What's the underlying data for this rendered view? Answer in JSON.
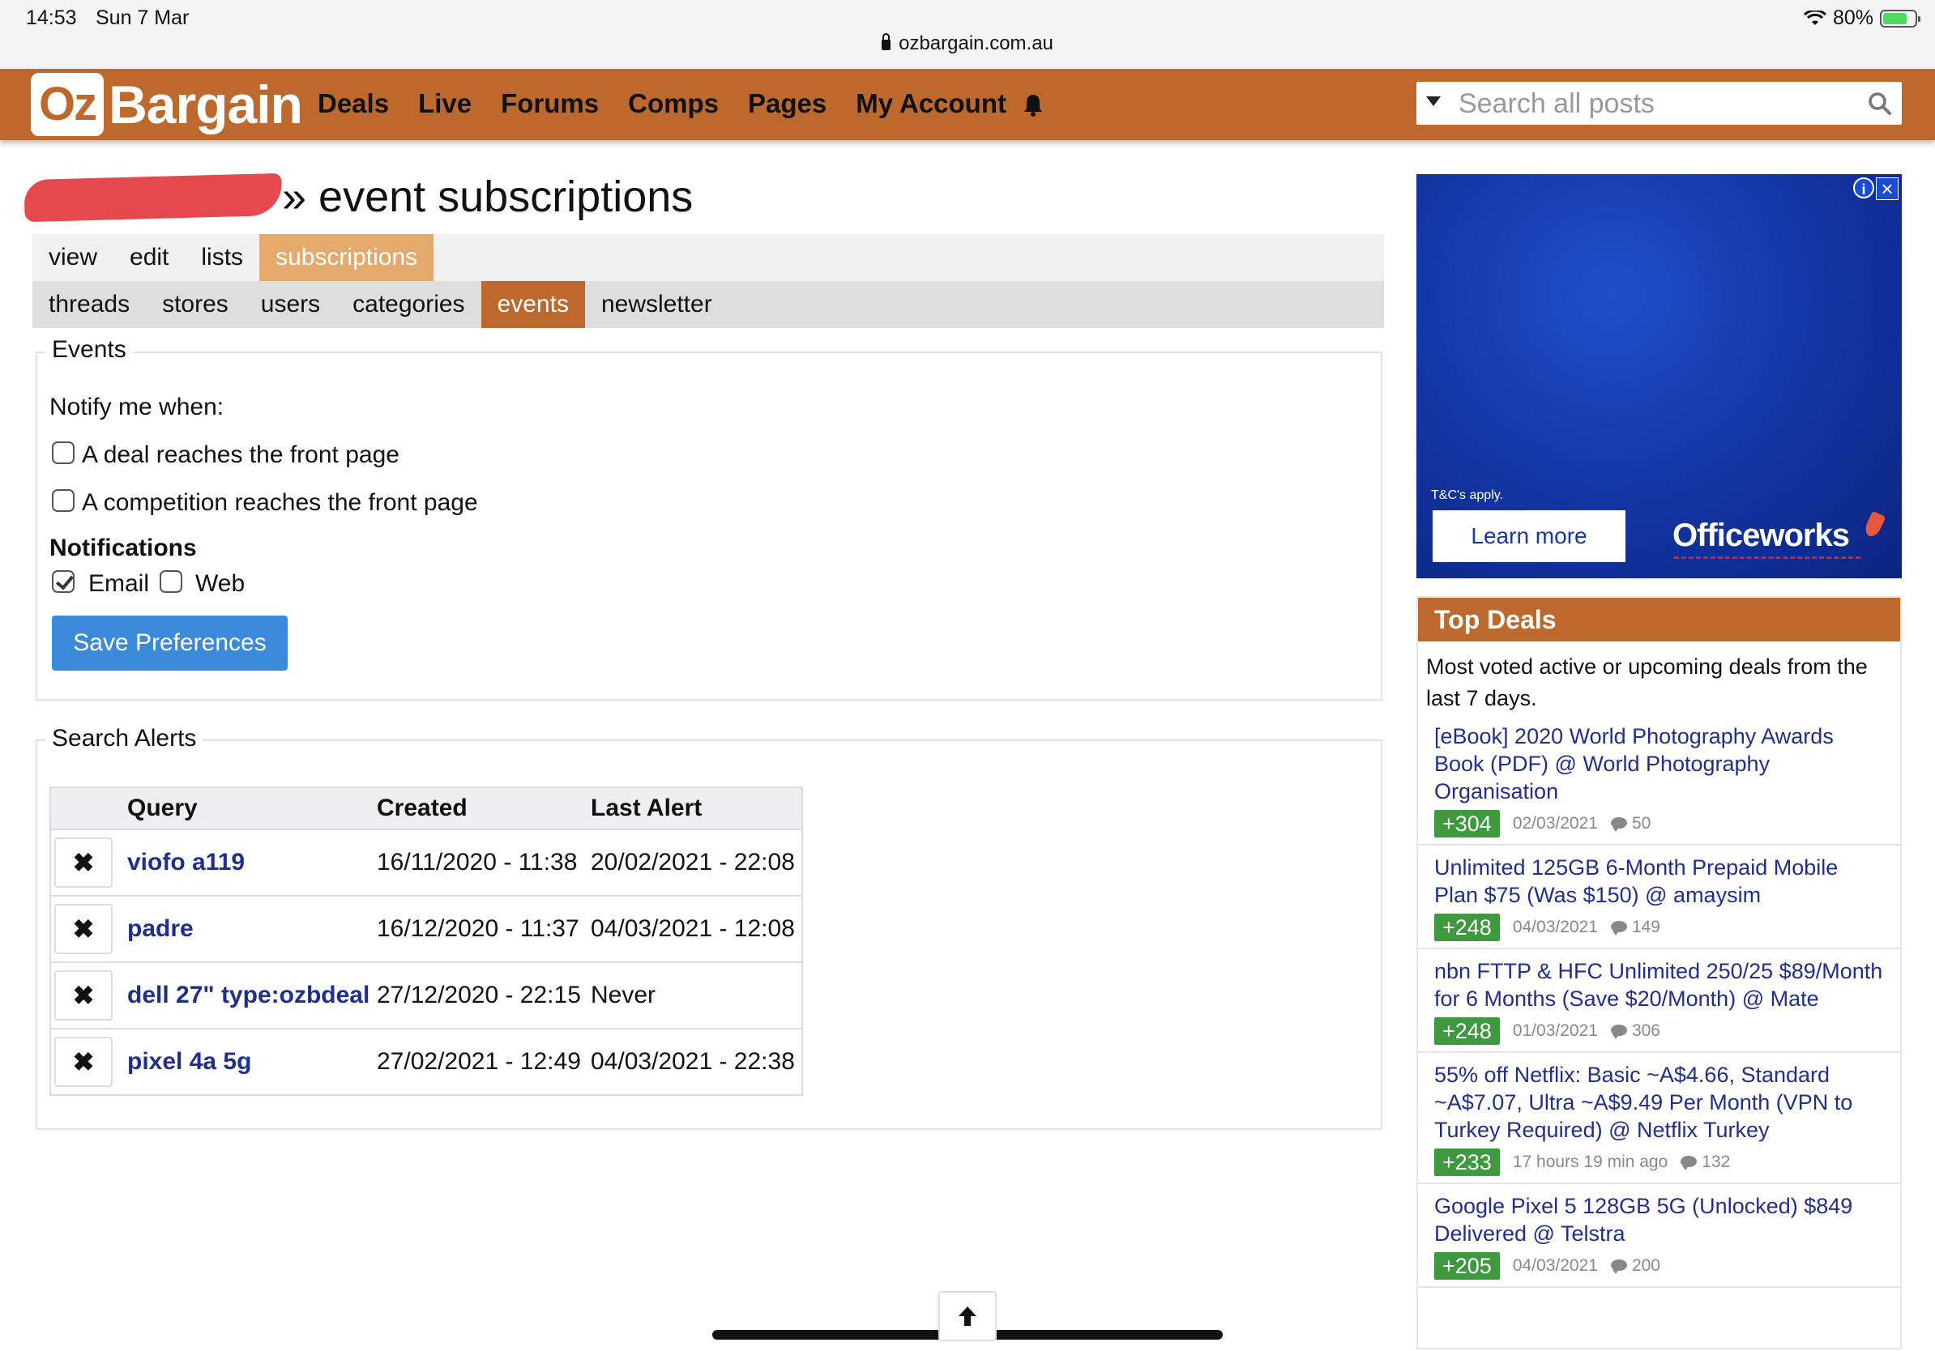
{
  "status_bar": {
    "time": "14:53",
    "date": "Sun 7 Mar",
    "url": "ozbargain.com.au",
    "battery": "80%"
  },
  "nav": {
    "logo": {
      "oz": "Oz",
      "bargain": "Bargain"
    },
    "items": [
      "Deals",
      "Live",
      "Forums",
      "Comps",
      "Pages",
      "My Account"
    ],
    "search_placeholder": "Search all posts"
  },
  "page": {
    "title": "» event subscriptions"
  },
  "tabs_primary": [
    "view",
    "edit",
    "lists",
    "subscriptions"
  ],
  "tabs_secondary": [
    "threads",
    "stores",
    "users",
    "categories",
    "events",
    "newsletter"
  ],
  "events": {
    "legend": "Events",
    "notify_label": "Notify me when:",
    "options": [
      {
        "label": "A deal reaches the front page",
        "checked": false
      },
      {
        "label": "A competition reaches the front page",
        "checked": false
      }
    ],
    "notifications_label": "Notifications",
    "email_label": "Email",
    "web_label": "Web",
    "save_label": "Save Preferences"
  },
  "alerts": {
    "legend": "Search Alerts",
    "headers": {
      "query": "Query",
      "created": "Created",
      "last_alert": "Last Alert"
    },
    "delete_icon": "✖",
    "rows": [
      {
        "query": "viofo a119",
        "created": "16/11/2020 - 11:38",
        "last_alert": "20/02/2021 - 22:08"
      },
      {
        "query": "padre",
        "created": "16/12/2020 - 11:37",
        "last_alert": "04/03/2021 - 12:08"
      },
      {
        "query": "dell 27\" type:ozbdeal",
        "created": "27/12/2020 - 22:15",
        "last_alert": "Never"
      },
      {
        "query": "pixel 4a 5g",
        "created": "27/02/2021 - 12:49",
        "last_alert": "04/03/2021 - 22:38"
      }
    ]
  },
  "ad": {
    "tc": "T&C's apply.",
    "learn_more": "Learn more",
    "brand": "Officeworks"
  },
  "top_deals": {
    "header": "Top Deals",
    "description": "Most voted active or upcoming deals from the last 7 days.",
    "deals": [
      {
        "title": "[eBook] 2020 World Photography Awards Book (PDF) @ World Photography Organisation",
        "votes": "+304",
        "date": "02/03/2021",
        "comments": "50"
      },
      {
        "title": "Unlimited 125GB 6-Month Prepaid Mobile Plan $75 (Was $150) @ amaysim",
        "votes": "+248",
        "date": "04/03/2021",
        "comments": "149"
      },
      {
        "title": "nbn FTTP & HFC Unlimited 250/25 $89/Month for 6 Months (Save $20/Month) @ Mate",
        "votes": "+248",
        "date": "01/03/2021",
        "comments": "306"
      },
      {
        "title": "55% off Netflix: Basic ~A$4.66, Standard ~A$7.07, Ultra ~A$9.49 Per Month (VPN to Turkey Required) @ Netflix Turkey",
        "votes": "+233",
        "date": "17 hours 19 min ago",
        "comments": "132"
      },
      {
        "title": "Google Pixel 5 128GB 5G (Unlocked) $849 Delivered @ Telstra",
        "votes": "+205",
        "date": "04/03/2021",
        "comments": "200"
      }
    ]
  },
  "colors": {
    "brand": "#bd692e",
    "tab_active_light": "#e4a96c",
    "button": "#3b8ad9",
    "link": "#1f2f8c",
    "votes": "#3f9a3f"
  }
}
